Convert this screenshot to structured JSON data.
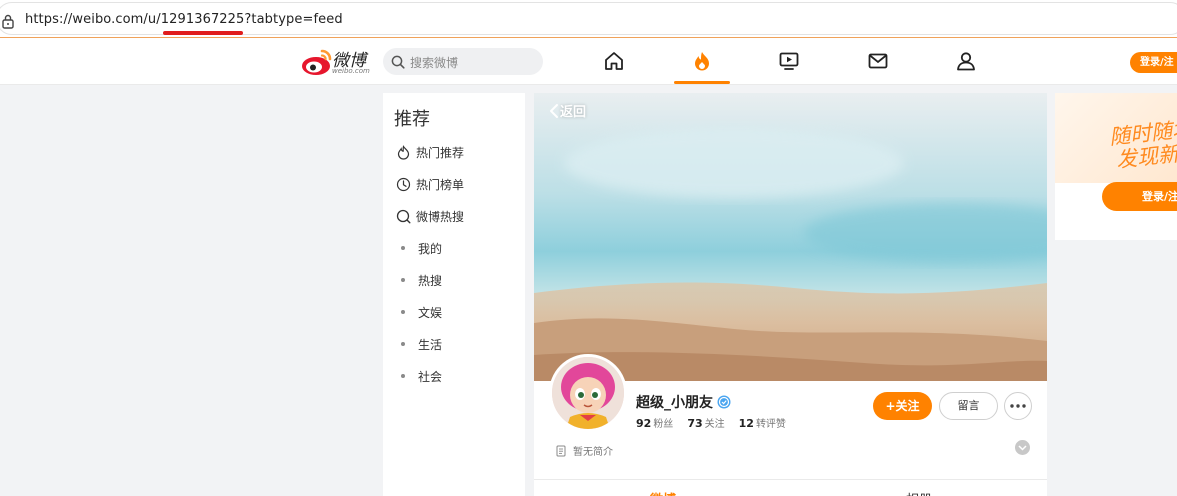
{
  "browser": {
    "url": "https://weibo.com/u/1291367225?tabtype=feed"
  },
  "header": {
    "logo_text": "微博",
    "logo_sub": "weibo.com",
    "search_placeholder": "搜索微博",
    "login_label": "登录/注",
    "nav": [
      "home-icon",
      "hot-flame-icon",
      "video-icon",
      "mail-icon",
      "profile-icon"
    ],
    "accent": "#ff8200"
  },
  "sidebar": {
    "title": "推荐",
    "items": [
      {
        "label": "热门推荐",
        "icon": "flame-icon"
      },
      {
        "label": "热门榜单",
        "icon": "clock-icon"
      },
      {
        "label": "微博热搜",
        "icon": "search-icon"
      },
      {
        "label": "我的",
        "icon": "dot"
      },
      {
        "label": "热搜",
        "icon": "dot"
      },
      {
        "label": "文娱",
        "icon": "dot"
      },
      {
        "label": "生活",
        "icon": "dot"
      },
      {
        "label": "社会",
        "icon": "dot"
      }
    ]
  },
  "profile": {
    "back_label": "返回",
    "username": "超级_小朋友",
    "followers_count": "92",
    "followers_label": "粉丝",
    "following_count": "73",
    "following_label": "关注",
    "reposts_count": "12",
    "reposts_label": "转评赞",
    "bio": "暂无简介",
    "follow_label": "+关注",
    "message_label": "留言",
    "tabs": [
      "微博",
      "相册"
    ]
  },
  "promo": {
    "line1": "随时随地",
    "line2": "发现新",
    "button": "登录/注"
  }
}
